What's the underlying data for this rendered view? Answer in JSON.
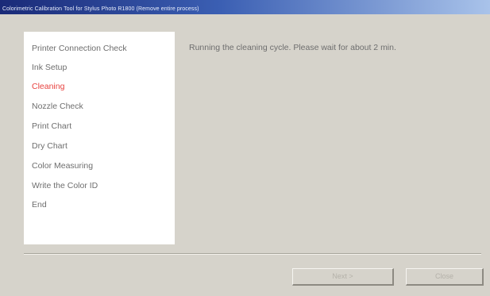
{
  "window": {
    "title": "Colorimetric Calibration Tool for Stylus Photo R1800 (Remove entire process)"
  },
  "steps": [
    {
      "label": "Printer Connection Check",
      "active": false
    },
    {
      "label": "Ink Setup",
      "active": false
    },
    {
      "label": "Cleaning",
      "active": true
    },
    {
      "label": "Nozzle Check",
      "active": false
    },
    {
      "label": "Print Chart",
      "active": false
    },
    {
      "label": "Dry Chart",
      "active": false
    },
    {
      "label": "Color Measuring",
      "active": false
    },
    {
      "label": "Write the Color ID",
      "active": false
    },
    {
      "label": "End",
      "active": false
    }
  ],
  "status": {
    "message": "Running the cleaning cycle. Please wait for about 2 min."
  },
  "buttons": {
    "next_label": "Next >",
    "close_label": "Close"
  },
  "colors": {
    "active_step": "#e8423f",
    "text": "#6e6e6e",
    "panel_background": "#ffffff",
    "window_background": "#d6d3cb",
    "titlebar_start": "#1a2a78",
    "titlebar_end": "#a9c3ea"
  }
}
